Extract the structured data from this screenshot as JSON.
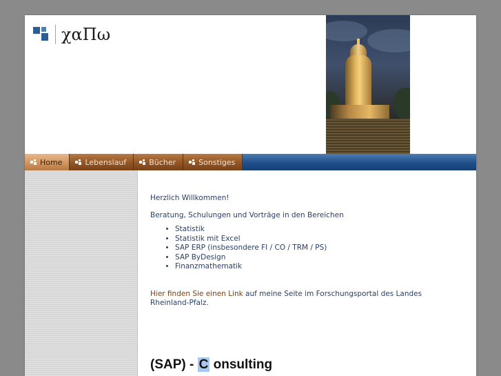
{
  "logo": {
    "text": "χαΠω"
  },
  "nav": {
    "items": [
      {
        "label": "Home",
        "active": true
      },
      {
        "label": "Lebenslauf",
        "active": false
      },
      {
        "label": "Bücher",
        "active": false
      },
      {
        "label": "Sonstiges",
        "active": false
      }
    ]
  },
  "content": {
    "welcome": "Herzlich Willkommen!",
    "intro": "Beratung, Schulungen und Vorträge in den Bereichen",
    "services": [
      "Statistik",
      "Statistik mit Excel",
      "SAP ERP (insbesondere FI / CO / TRM / PS)",
      "SAP ByDesign",
      "Finanzmathematik"
    ],
    "link_text": "Hier finden Sie einen Link",
    "link_suffix": " auf meine Seite im Forschungsportal des Landes Rheinland-Pfalz.",
    "heading_prefix": "(SAP) - ",
    "heading_highlight": "C",
    "heading_suffix": " onsulting"
  },
  "colors": {
    "nav_blue": "#1f4f88",
    "nav_tab": "#8e5224",
    "nav_tab_active": "#cf935e",
    "text": "#2a3e66",
    "link": "#7a3f12",
    "background": "#8a8a8a"
  }
}
